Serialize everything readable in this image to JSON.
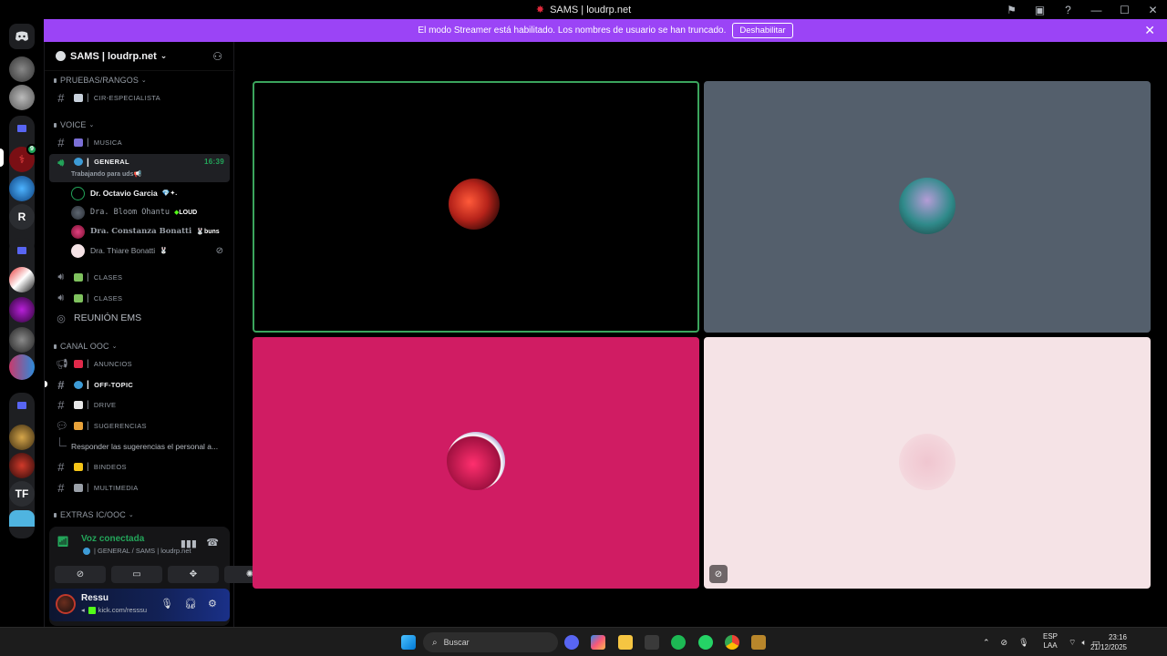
{
  "window": {
    "title": "SAMS | loudrp.net",
    "controls": [
      "flag-icon",
      "inbox-icon",
      "help-icon",
      "minimize-icon",
      "maximize-icon",
      "close-icon"
    ]
  },
  "banner": {
    "message": "El modo Streamer está habilitado. Los nombres de usuario se han truncado.",
    "button": "Deshabilitar",
    "close": "✕"
  },
  "rail": {
    "text_servers": [
      "R",
      "TF"
    ],
    "notification_badge": "9"
  },
  "server": {
    "name": "SAMS | loudrp.net",
    "chevron": "⌄"
  },
  "categories": {
    "pruebas": "PRUEBAS/RANGOS",
    "voice": "VOICE",
    "canal_ooc": "CANAL OOC",
    "extras": "EXTRAS IC/OOC"
  },
  "channels": {
    "cir": "CIR-ESPECIALISTA",
    "musica": "MUSICA",
    "general": "GENERAL",
    "general_time": "16:39",
    "general_status": "Trabajando para uds📢",
    "clases1": "CLASES",
    "clases2": "CLASES",
    "reunion": "REUNIÓN EMS",
    "anuncios": "ANUNCIOS",
    "offtopic": "OFF-TOPIC",
    "drive": "DRIVE",
    "sugerencias": "SUGERENCIAS",
    "thread": "Responder las sugerencias el personal a...",
    "bindeos": "BINDEOS",
    "multimedia": "MULTIMEDIA"
  },
  "voice_users": [
    {
      "name": "Dr. Octavio Garcia",
      "tag": "💎✦."
    },
    {
      "name": "Dra. Bloom Ohantu",
      "tag": "LOUD"
    },
    {
      "name": "Dra. Constanza Bonatti",
      "tag": "buns"
    },
    {
      "name": "Dra. Thiare Bonatti",
      "tag": "🐰"
    }
  ],
  "voice_panel": {
    "status": "Voz conectada",
    "location": "| GENERAL / SAMS | loudrp.net"
  },
  "user": {
    "name": "Ressu",
    "status": "kick.com/resssu"
  },
  "tiles": [
    {
      "bg": "#000000",
      "speaking": true
    },
    {
      "bg": "#545f6c",
      "speaking": false
    },
    {
      "bg": "#d01c63",
      "speaking": false
    },
    {
      "bg": "#f5e3e6",
      "speaking": false,
      "muted": true
    }
  ],
  "taskbar": {
    "search": "Buscar",
    "lang1": "ESP",
    "lang2": "LAA",
    "time": "23:16",
    "date": "21/12/2025"
  }
}
